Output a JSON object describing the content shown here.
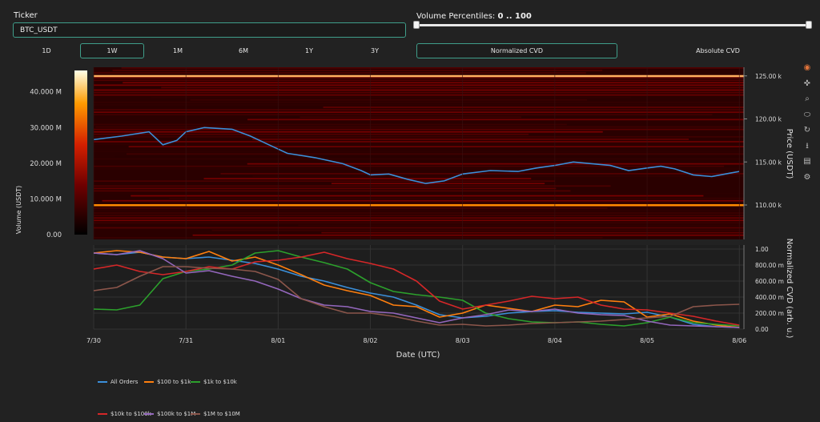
{
  "ticker": {
    "label": "Ticker",
    "value": "BTC_USDT"
  },
  "volume_range": {
    "label": "Volume Percentiles: ",
    "value": "0 .. 100"
  },
  "timeframes": [
    "1D",
    "1W",
    "1M",
    "6M",
    "1Y",
    "3Y"
  ],
  "active_timeframe": 1,
  "cvd_modes": [
    "Normalized CVD",
    "Absolute CVD"
  ],
  "active_cvd_mode": 0,
  "toolbar": [
    "palette-icon",
    "pan-icon",
    "zoom-icon",
    "lasso-icon",
    "reset-icon",
    "download-icon",
    "comment-icon",
    "settings-icon"
  ],
  "colors": {
    "background": "#222222",
    "accent": "#3f9e8a",
    "price_line": "#3b8fd9"
  },
  "chart_data": [
    {
      "type": "heatmap",
      "y_title": "Price (USDT)",
      "colorbar_title": "Volume (USDT)",
      "ylim": [
        106000,
        126000
      ],
      "y_ticks": [
        110000,
        115000,
        120000,
        125000
      ],
      "y_tick_labels": [
        "110.00 k",
        "115.00 k",
        "120.00 k",
        "125.00 k"
      ],
      "colorbar_range": [
        0,
        46000000
      ],
      "colorbar_ticks": [
        0,
        10000000,
        20000000,
        30000000,
        40000000
      ],
      "colorbar_tick_labels": [
        "0.00",
        "10.000 M",
        "20.000 M",
        "30.000 M",
        "40.000 M"
      ],
      "bright_levels": [
        125000,
        110000
      ],
      "xlim": [
        0,
        7.05
      ],
      "price_x": [
        0,
        0.3,
        0.6,
        0.75,
        0.9,
        1.0,
        1.2,
        1.5,
        1.7,
        1.9,
        2.1,
        2.4,
        2.7,
        2.9,
        3.0,
        3.2,
        3.4,
        3.6,
        3.8,
        4.0,
        4.3,
        4.6,
        4.8,
        5.0,
        5.2,
        5.4,
        5.6,
        5.8,
        6.0,
        6.15,
        6.3,
        6.5,
        6.7,
        6.9,
        7.0
      ],
      "price_y": [
        117600,
        118000,
        118500,
        117000,
        117500,
        118500,
        119000,
        118800,
        118000,
        117000,
        116000,
        115500,
        114800,
        114000,
        113500,
        113600,
        113000,
        112500,
        112800,
        113600,
        114000,
        113900,
        114300,
        114600,
        115000,
        114800,
        114600,
        114000,
        114300,
        114500,
        114200,
        113500,
        113300,
        113700,
        113900
      ]
    },
    {
      "type": "line",
      "xlabel": "Date (UTC)",
      "ylabel": "Normalized CVD (arb. u.)",
      "ylim": [
        0,
        1.05
      ],
      "y_ticks": [
        0,
        0.2,
        0.4,
        0.6,
        0.8,
        1.0
      ],
      "y_tick_labels": [
        "0.00",
        "200.00 m",
        "400.00 m",
        "600.00 m",
        "800.00 m",
        "1.00"
      ],
      "x_ticks": [
        0,
        1,
        2,
        3,
        4,
        5,
        6,
        7
      ],
      "x_tick_labels": [
        "7/30",
        "7/31",
        "8/01",
        "8/02",
        "8/03",
        "8/04",
        "8/05",
        "8/06"
      ],
      "xlim": [
        0,
        7.05
      ],
      "x": [
        0,
        0.25,
        0.5,
        0.75,
        1.0,
        1.25,
        1.5,
        1.75,
        2.0,
        2.25,
        2.5,
        2.75,
        3.0,
        3.25,
        3.5,
        3.75,
        4.0,
        4.25,
        4.5,
        4.75,
        5.0,
        5.25,
        5.5,
        5.75,
        6.0,
        6.25,
        6.5,
        6.75,
        7.0
      ],
      "series": [
        {
          "name": "All Orders",
          "color": "#3b8fd9",
          "values": [
            0.95,
            0.93,
            0.96,
            0.9,
            0.88,
            0.9,
            0.86,
            0.82,
            0.75,
            0.66,
            0.6,
            0.52,
            0.45,
            0.4,
            0.3,
            0.18,
            0.14,
            0.16,
            0.2,
            0.22,
            0.23,
            0.21,
            0.2,
            0.19,
            0.21,
            0.15,
            0.06,
            0.03,
            0.02
          ]
        },
        {
          "name": "$100 to $1k",
          "color": "#ff7f0e",
          "values": [
            0.95,
            0.98,
            0.96,
            0.9,
            0.88,
            0.97,
            0.85,
            0.9,
            0.8,
            0.68,
            0.55,
            0.48,
            0.42,
            0.3,
            0.28,
            0.15,
            0.2,
            0.3,
            0.26,
            0.22,
            0.3,
            0.28,
            0.36,
            0.34,
            0.15,
            0.19,
            0.1,
            0.05,
            0.02
          ]
        },
        {
          "name": "$1k to $10k",
          "color": "#2ca02c",
          "values": [
            0.25,
            0.24,
            0.3,
            0.63,
            0.72,
            0.75,
            0.8,
            0.95,
            0.98,
            0.9,
            0.83,
            0.75,
            0.58,
            0.47,
            0.43,
            0.4,
            0.36,
            0.2,
            0.13,
            0.09,
            0.08,
            0.09,
            0.06,
            0.04,
            0.08,
            0.15,
            0.08,
            0.06,
            0.04
          ]
        },
        {
          "name": "$10k to $100k",
          "color": "#d62728",
          "values": [
            0.75,
            0.8,
            0.72,
            0.68,
            0.72,
            0.78,
            0.75,
            0.84,
            0.86,
            0.9,
            0.96,
            0.88,
            0.82,
            0.75,
            0.6,
            0.35,
            0.25,
            0.3,
            0.35,
            0.41,
            0.38,
            0.4,
            0.3,
            0.25,
            0.24,
            0.2,
            0.16,
            0.1,
            0.05
          ]
        },
        {
          "name": "$100k to $1M",
          "color": "#9467bd",
          "values": [
            0.95,
            0.93,
            0.98,
            0.88,
            0.7,
            0.73,
            0.66,
            0.6,
            0.5,
            0.38,
            0.3,
            0.28,
            0.22,
            0.2,
            0.14,
            0.08,
            0.14,
            0.18,
            0.24,
            0.22,
            0.25,
            0.2,
            0.18,
            0.17,
            0.1,
            0.05,
            0.04,
            0.03,
            0.02
          ]
        },
        {
          "name": "$1M to $10M",
          "color": "#8c564b",
          "values": [
            0.48,
            0.52,
            0.66,
            0.78,
            0.78,
            0.76,
            0.75,
            0.72,
            0.62,
            0.38,
            0.28,
            0.2,
            0.2,
            0.16,
            0.1,
            0.05,
            0.06,
            0.04,
            0.05,
            0.07,
            0.08,
            0.09,
            0.1,
            0.12,
            0.14,
            0.16,
            0.28,
            0.3,
            0.31
          ]
        }
      ]
    }
  ]
}
